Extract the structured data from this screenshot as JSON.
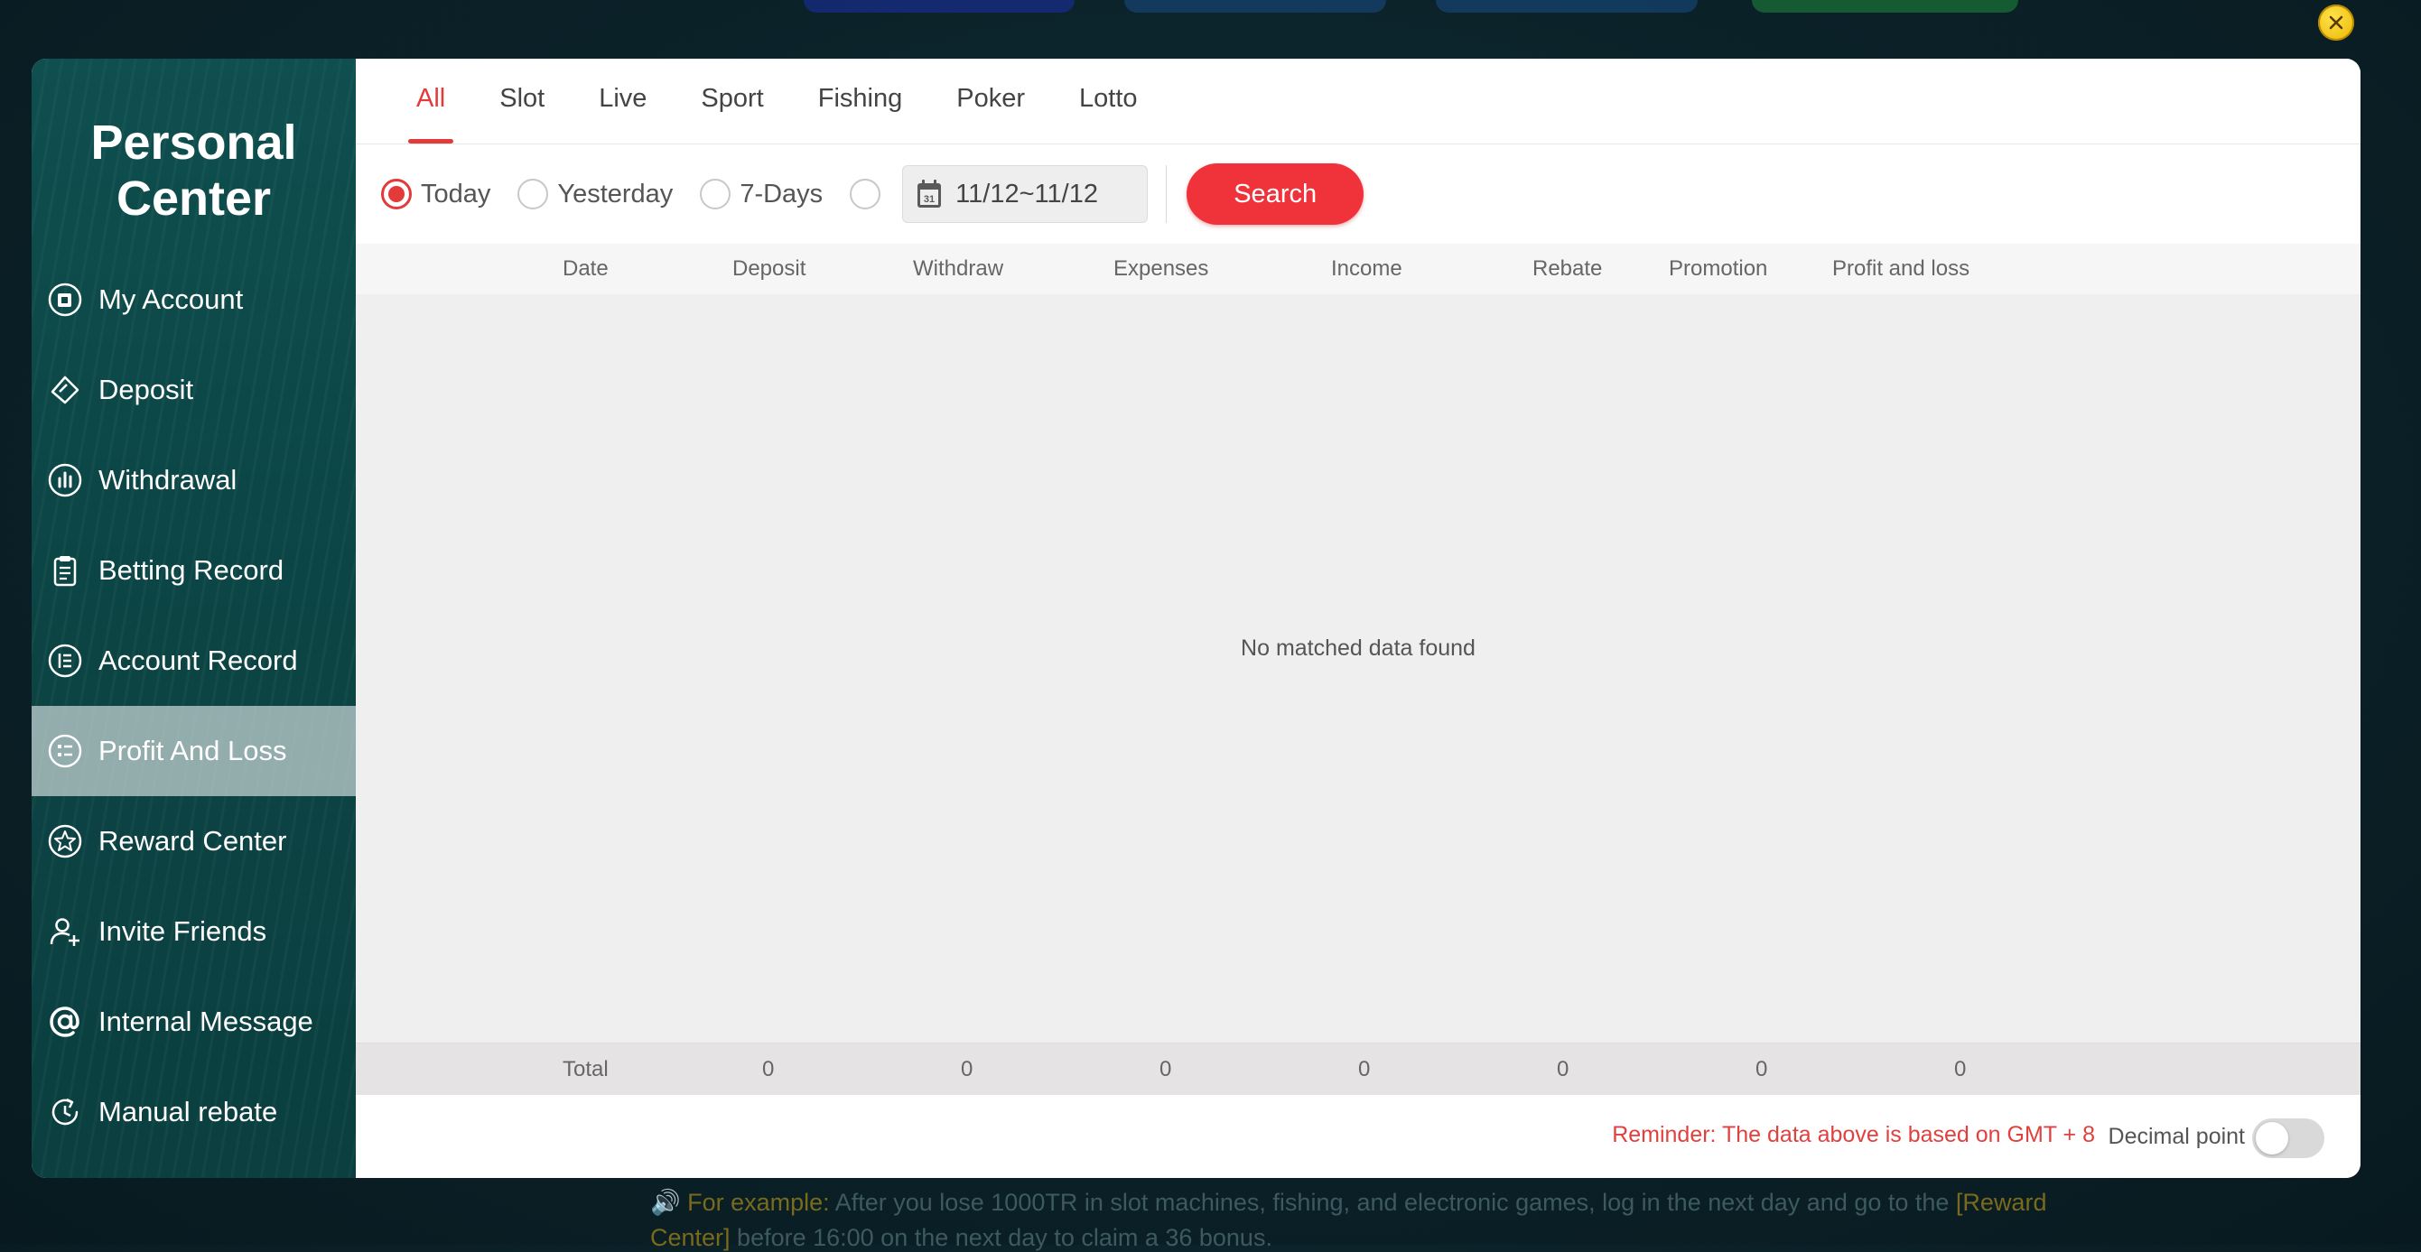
{
  "backdrop": {
    "pill_colors": [
      "#1c2fa8",
      "#1a4f86",
      "#1a4f86",
      "#1f8a3a"
    ],
    "line1_highlight": "🔊 For example:",
    "line1": " After you lose 1000TR in slot machines, fishing, and electronic games, log in the next day and go to the ",
    "line1_highlight_end": "[Reward",
    "line2_highlight": "Center]",
    "line2": " before 16:00 on the next day to claim a 36 bonus."
  },
  "sidebar": {
    "title_line1": "Personal",
    "title_line2": "Center",
    "items": [
      {
        "label": "My Account",
        "icon": "account-icon"
      },
      {
        "label": "Deposit",
        "icon": "deposit-icon"
      },
      {
        "label": "Withdrawal",
        "icon": "withdrawal-icon"
      },
      {
        "label": "Betting Record",
        "icon": "clipboard-icon"
      },
      {
        "label": "Account Record",
        "icon": "ledger-icon"
      },
      {
        "label": "Profit And Loss",
        "icon": "profit-loss-icon",
        "active": true
      },
      {
        "label": "Reward Center",
        "icon": "star-icon"
      },
      {
        "label": "Invite Friends",
        "icon": "add-user-icon"
      },
      {
        "label": "Internal Message",
        "icon": "at-icon"
      },
      {
        "label": "Manual rebate",
        "icon": "rebate-icon"
      }
    ]
  },
  "tabs": [
    {
      "label": "All",
      "active": true
    },
    {
      "label": "Slot"
    },
    {
      "label": "Live"
    },
    {
      "label": "Sport"
    },
    {
      "label": "Fishing"
    },
    {
      "label": "Poker"
    },
    {
      "label": "Lotto"
    }
  ],
  "filters": {
    "today": "Today",
    "yesterday": "Yesterday",
    "seven_days": "7-Days",
    "date_range": "11/12~11/12",
    "search": "Search"
  },
  "table": {
    "columns": [
      "Date",
      "Deposit",
      "Withdraw",
      "Expenses",
      "Income",
      "Rebate",
      "Promotion",
      "Profit and loss"
    ],
    "empty_message": "No matched data found",
    "total_label": "Total",
    "totals": [
      "0",
      "0",
      "0",
      "0",
      "0",
      "0",
      "0"
    ]
  },
  "footer": {
    "reminder": "Reminder: The data above is based on GMT + 8",
    "decimal_label": "Decimal point",
    "decimal_on": false
  },
  "colors": {
    "accent": "#f0333a",
    "sidebar": "#0c4545",
    "close_button": "#f5cc12"
  }
}
